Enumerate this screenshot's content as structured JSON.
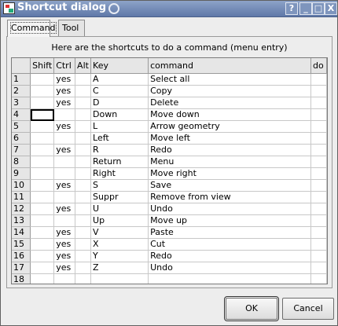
{
  "window": {
    "title": "Shortcut dialog",
    "controls": {
      "help": "?",
      "minimize": "_",
      "maximize": "□",
      "close": "X"
    }
  },
  "tabs": [
    {
      "label": "Command",
      "active": true
    },
    {
      "label": "Tool",
      "active": false
    }
  ],
  "caption": "Here are the shortcuts to do a command (menu entry)",
  "table": {
    "columns": [
      "Shift",
      "Ctrl",
      "Alt",
      "Key",
      "command",
      "do"
    ],
    "rows": [
      {
        "num": "1",
        "shift": "",
        "ctrl": "yes",
        "alt": "",
        "key": "A",
        "command": "Select all",
        "do": ""
      },
      {
        "num": "2",
        "shift": "",
        "ctrl": "yes",
        "alt": "",
        "key": "C",
        "command": "Copy",
        "do": ""
      },
      {
        "num": "3",
        "shift": "",
        "ctrl": "yes",
        "alt": "",
        "key": "D",
        "command": "Delete",
        "do": ""
      },
      {
        "num": "4",
        "shift": "",
        "ctrl": "",
        "alt": "",
        "key": "Down",
        "command": "Move down",
        "do": ""
      },
      {
        "num": "5",
        "shift": "",
        "ctrl": "yes",
        "alt": "",
        "key": "L",
        "command": "Arrow geometry",
        "do": ""
      },
      {
        "num": "6",
        "shift": "",
        "ctrl": "",
        "alt": "",
        "key": "Left",
        "command": "Move left",
        "do": ""
      },
      {
        "num": "7",
        "shift": "",
        "ctrl": "yes",
        "alt": "",
        "key": "R",
        "command": "Redo",
        "do": ""
      },
      {
        "num": "8",
        "shift": "",
        "ctrl": "",
        "alt": "",
        "key": "Return",
        "command": "Menu",
        "do": ""
      },
      {
        "num": "9",
        "shift": "",
        "ctrl": "",
        "alt": "",
        "key": "Right",
        "command": "Move right",
        "do": ""
      },
      {
        "num": "10",
        "shift": "",
        "ctrl": "yes",
        "alt": "",
        "key": "S",
        "command": "Save",
        "do": ""
      },
      {
        "num": "11",
        "shift": "",
        "ctrl": "",
        "alt": "",
        "key": "Suppr",
        "command": "Remove from view",
        "do": ""
      },
      {
        "num": "12",
        "shift": "",
        "ctrl": "yes",
        "alt": "",
        "key": "U",
        "command": "Undo",
        "do": ""
      },
      {
        "num": "13",
        "shift": "",
        "ctrl": "",
        "alt": "",
        "key": "Up",
        "command": "Move up",
        "do": ""
      },
      {
        "num": "14",
        "shift": "",
        "ctrl": "yes",
        "alt": "",
        "key": "V",
        "command": "Paste",
        "do": ""
      },
      {
        "num": "15",
        "shift": "",
        "ctrl": "yes",
        "alt": "",
        "key": "X",
        "command": "Cut",
        "do": ""
      },
      {
        "num": "16",
        "shift": "",
        "ctrl": "yes",
        "alt": "",
        "key": "Y",
        "command": "Redo",
        "do": ""
      },
      {
        "num": "17",
        "shift": "",
        "ctrl": "yes",
        "alt": "",
        "key": "Z",
        "command": "Undo",
        "do": ""
      },
      {
        "num": "18",
        "shift": "",
        "ctrl": "",
        "alt": "",
        "key": "",
        "command": "",
        "do": ""
      }
    ]
  },
  "buttons": {
    "ok": "OK",
    "cancel": "Cancel"
  },
  "colors": {
    "titlebar": "#6f87b4",
    "dialog_bg": "#ededed",
    "grid_header": "#e6e6e6"
  },
  "icons": {
    "window": "app-window-icon"
  }
}
